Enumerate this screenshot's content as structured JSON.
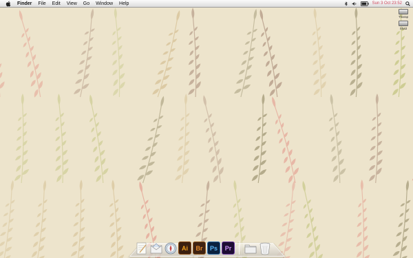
{
  "menubar": {
    "apple_icon": "apple-icon",
    "items": [
      "Finder",
      "File",
      "Edit",
      "View",
      "Go",
      "Window",
      "Help"
    ],
    "status_icons": [
      "spotlight-icon",
      "bluetooth-icon",
      "volume-icon",
      "battery-icon"
    ],
    "clock": "Sun 3 Oct 23:52",
    "clock_color": "#d24a5f"
  },
  "desktop": {
    "icons": [
      {
        "icon": "hard-drive-icon",
        "label": "Tharap"
      },
      {
        "icon": "hard-drive-icon",
        "label": "Sha3"
      }
    ],
    "wallpaper": {
      "pattern": "leaf-pattern",
      "background": "#ede4cc",
      "leaf_colors": [
        "#c9c98a",
        "#b59a86",
        "#e49e90",
        "#d8c49a",
        "#a59c7a"
      ]
    }
  },
  "dock": {
    "items": [
      {
        "name": "textedit",
        "icon": "textedit-icon",
        "label": ""
      },
      {
        "name": "mail",
        "icon": "mail-icon",
        "label": ""
      },
      {
        "name": "safari",
        "icon": "safari-icon",
        "label": ""
      },
      {
        "name": "illustrator",
        "icon": "illustrator-icon",
        "label": "Ai"
      },
      {
        "name": "bridge",
        "icon": "bridge-icon",
        "label": "Br"
      },
      {
        "name": "photoshop",
        "icon": "photoshop-icon",
        "label": "Ps"
      },
      {
        "name": "premiere",
        "icon": "premiere-icon",
        "label": "Pr"
      },
      {
        "name": "downloads",
        "icon": "folder-icon",
        "label": ""
      },
      {
        "name": "trash",
        "icon": "trash-icon",
        "label": ""
      }
    ]
  }
}
